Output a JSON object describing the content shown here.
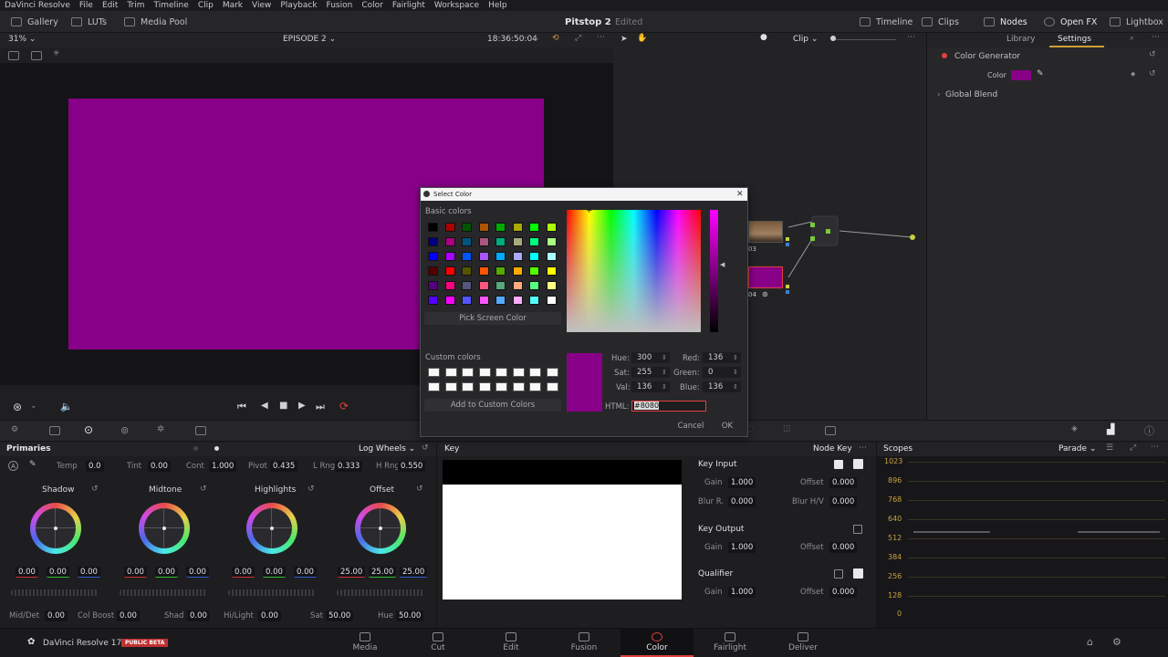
{
  "menu": [
    "DaVinci Resolve",
    "File",
    "Edit",
    "Trim",
    "Timeline",
    "Clip",
    "Mark",
    "View",
    "Playback",
    "Fusion",
    "Color",
    "Fairlight",
    "Workspace",
    "Help"
  ],
  "toolbar": {
    "gallery": "Gallery",
    "luts": "LUTs",
    "media_pool": "Media Pool",
    "project": "Pitstop 2",
    "project_status": "Edited",
    "timeline": "Timeline",
    "clips": "Clips",
    "nodes": "Nodes",
    "open_fx": "Open FX",
    "lightbox": "Lightbox"
  },
  "viewer": {
    "zoom": "31%",
    "timeline_name": "EPISODE 2",
    "timecode": "18:36:50:04",
    "canvas_color": "#880088"
  },
  "node_editor": {
    "mode": "Clip",
    "node1_label": "03",
    "node2_label": "04"
  },
  "settings": {
    "tab_library": "Library",
    "tab_settings": "Settings",
    "generator": "Color Generator",
    "color_label": "Color",
    "global_blend": "Global Blend"
  },
  "dialog": {
    "title": "Select Color",
    "basic_colors_label": "Basic colors",
    "pick_screen": "Pick Screen Color",
    "custom_colors_label": "Custom colors",
    "add_custom": "Add to Custom Colors",
    "hue_label": "Hue:",
    "hue": "300",
    "sat_label": "Sat:",
    "sat": "255",
    "val_label": "Val:",
    "val": "136",
    "red_label": "Red:",
    "red": "136",
    "green_label": "Green:",
    "green": "0",
    "blue_label": "Blue:",
    "blue": "136",
    "html_label": "HTML:",
    "html_value": "#8080",
    "cancel": "Cancel",
    "ok": "OK",
    "current_color": "#880088",
    "basic_colors": [
      "#000000",
      "#aa0000",
      "#005500",
      "#aa5500",
      "#00aa00",
      "#aaaa00",
      "#00ff00",
      "#aaff00",
      "#00007f",
      "#aa007f",
      "#00557f",
      "#aa557f",
      "#00aa7f",
      "#aaaa7f",
      "#00ff7f",
      "#aaff7f",
      "#0000ff",
      "#aa00ff",
      "#0055ff",
      "#aa55ff",
      "#00aaff",
      "#aaaaff",
      "#00ffff",
      "#aaffff",
      "#550000",
      "#ff0000",
      "#555500",
      "#ff5500",
      "#55aa00",
      "#ffaa00",
      "#55ff00",
      "#ffff00",
      "#55007f",
      "#ff007f",
      "#55557f",
      "#ff557f",
      "#55aa7f",
      "#ffaa7f",
      "#55ff7f",
      "#ffff7f",
      "#5500ff",
      "#ff00ff",
      "#5555ff",
      "#ff55ff",
      "#55aaff",
      "#ffaaff",
      "#55ffff",
      "#ffffff"
    ]
  },
  "primaries": {
    "title": "Primaries",
    "mode": "Log Wheels",
    "temp_label": "Temp",
    "temp": "0.0",
    "tint_label": "Tint",
    "tint": "0.00",
    "cont_label": "Cont",
    "cont": "1.000",
    "pivot_label": "Pivot",
    "pivot": "0.435",
    "lrng_label": "L Rng",
    "lrng": "0.333",
    "hrng_label": "H Rng",
    "hrng": "0.550",
    "wheels": [
      {
        "name": "Shadow",
        "vals": [
          "0.00",
          "0.00",
          "0.00"
        ]
      },
      {
        "name": "Midtone",
        "vals": [
          "0.00",
          "0.00",
          "0.00"
        ]
      },
      {
        "name": "Highlights",
        "vals": [
          "0.00",
          "0.00",
          "0.00"
        ]
      },
      {
        "name": "Offset",
        "vals": [
          "25.00",
          "25.00",
          "25.00"
        ]
      }
    ],
    "middet_label": "Mid/Det",
    "middet": "0.00",
    "colboost_label": "Col Boost",
    "colboost": "0.00",
    "shad_label": "Shad",
    "shad": "0.00",
    "hilight_label": "Hi/Light",
    "hilight": "0.00",
    "sat_label": "Sat",
    "sat": "50.00",
    "hue_label": "Hue",
    "hue": "50.00"
  },
  "key": {
    "title": "Key",
    "node_key": "Node Key",
    "key_input": "Key Input",
    "gain_label": "Gain",
    "input_gain": "1.000",
    "offset_label": "Offset",
    "input_offset": "0.000",
    "blurr_label": "Blur R.",
    "blur_r": "0.000",
    "blurhv_label": "Blur H/V",
    "blur_hv": "0.000",
    "key_output": "Key Output",
    "output_gain": "1.000",
    "output_offset": "0.000",
    "qualifier": "Qualifier",
    "qual_gain": "1.000",
    "qual_offset": "0.000"
  },
  "scopes": {
    "title": "Scopes",
    "mode": "Parade",
    "ticks": [
      "1023",
      "896",
      "768",
      "640",
      "512",
      "384",
      "256",
      "128",
      "0"
    ]
  },
  "pages": {
    "app": "DaVinci Resolve 17",
    "beta": "PUBLIC BETA",
    "items": [
      "Media",
      "Cut",
      "Edit",
      "Fusion",
      "Color",
      "Fairlight",
      "Deliver"
    ]
  }
}
